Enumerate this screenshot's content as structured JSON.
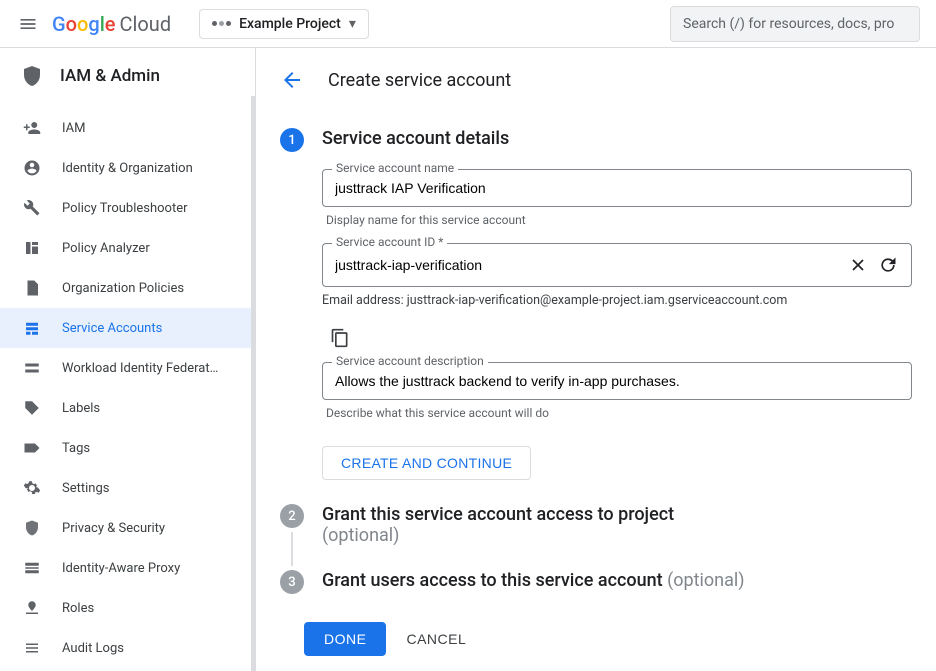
{
  "topbar": {
    "logo_google": "Google",
    "logo_cloud": "Cloud",
    "project_name": "Example Project",
    "search_placeholder": "Search (/) for resources, docs, pro"
  },
  "section_title": "IAM & Admin",
  "nav": [
    {
      "icon": "iam",
      "label": "IAM"
    },
    {
      "icon": "identity",
      "label": "Identity & Organization"
    },
    {
      "icon": "wrench",
      "label": "Policy Troubleshooter"
    },
    {
      "icon": "analyzer",
      "label": "Policy Analyzer"
    },
    {
      "icon": "doc",
      "label": "Organization Policies"
    },
    {
      "icon": "accounts",
      "label": "Service Accounts",
      "active": true
    },
    {
      "icon": "federation",
      "label": "Workload Identity Federat…"
    },
    {
      "icon": "tag",
      "label": "Labels"
    },
    {
      "icon": "tags",
      "label": "Tags"
    },
    {
      "icon": "gear",
      "label": "Settings"
    },
    {
      "icon": "shield",
      "label": "Privacy & Security"
    },
    {
      "icon": "iap",
      "label": "Identity-Aware Proxy"
    },
    {
      "icon": "roles",
      "label": "Roles"
    },
    {
      "icon": "logs",
      "label": "Audit Logs"
    }
  ],
  "page": {
    "title": "Create service account"
  },
  "step1": {
    "title": "Service account details",
    "name_label": "Service account name",
    "name_value": "justtrack IAP Verification",
    "name_helper": "Display name for this service account",
    "id_label": "Service account ID *",
    "id_value": "justtrack-iap-verification",
    "email_prefix": "Email address: ",
    "email_value": "justtrack-iap-verification@example-project.iam.gserviceaccount.com",
    "desc_label": "Service account description",
    "desc_value": "Allows the justtrack backend to verify in-app purchases.",
    "desc_helper": "Describe what this service account will do",
    "create_continue": "CREATE AND CONTINUE"
  },
  "step2": {
    "title": "Grant this service account access to project",
    "optional": "(optional)"
  },
  "step3": {
    "title": "Grant users access to this service account ",
    "optional": "(optional)"
  },
  "actions": {
    "done": "DONE",
    "cancel": "CANCEL"
  }
}
